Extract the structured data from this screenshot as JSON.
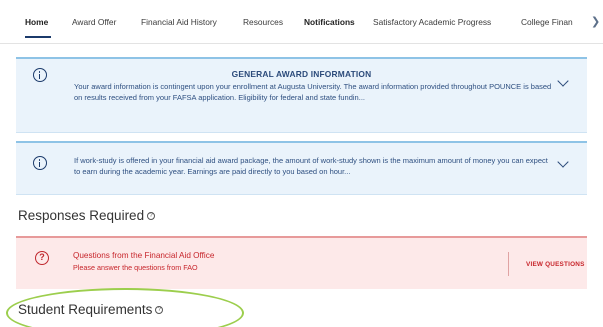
{
  "tabs": {
    "items": [
      {
        "label": "Home"
      },
      {
        "label": "Award Offer"
      },
      {
        "label": "Financial Aid History"
      },
      {
        "label": "Resources"
      },
      {
        "label": "Notifications"
      },
      {
        "label": "Satisfactory Academic Progress"
      },
      {
        "label": "College Finan"
      }
    ],
    "active": "Home",
    "next_icon": "chevron-right-icon"
  },
  "general_award": {
    "title": "GENERAL AWARD INFORMATION",
    "text": "Your award information is contingent upon your enrollment at Augusta University. The award information provided throughout POUNCE is based on results received from your FAFSA application. Eligibility for federal and state fundin...",
    "icon": "info-icon"
  },
  "work_study": {
    "text": "If work-study is offered in your financial aid award package, the amount of work-study shown is the maximum amount of money you can expect to earn during the academic year. Earnings are paid directly to you based on hour...",
    "icon": "info-icon"
  },
  "responses": {
    "title": "Responses Required",
    "help_glyph": "?"
  },
  "alert": {
    "icon_glyph": "?",
    "title": "Questions from the Financial Aid Office",
    "subtitle": "Please answer the questions from FAO",
    "button": "VIEW QUESTIONS"
  },
  "requirements": {
    "title": "Student Requirements",
    "help_glyph": "?"
  },
  "colors": {
    "info_bg": "#eaf3fb",
    "info_border": "#8ec3e6",
    "alert_bg": "#fde9e9",
    "alert_text": "#c7252b",
    "highlight": "#9cce4d"
  }
}
